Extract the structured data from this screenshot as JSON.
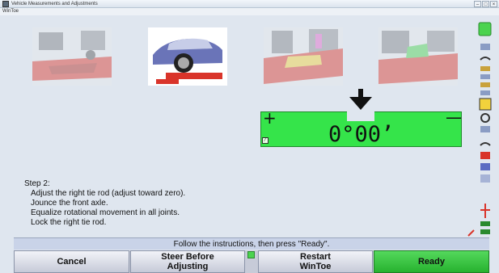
{
  "window": {
    "title": "Vehicle Measurements and Adjustments",
    "menu_label": "WinToe",
    "buttons": {
      "minimize": "–",
      "maximize": "□",
      "close": "×"
    }
  },
  "thumbnails": [
    {
      "name": "thumb-suspension-1",
      "icon": "suspension-icon"
    },
    {
      "name": "thumb-car-on-lift",
      "icon": "car-on-lift-icon"
    },
    {
      "name": "thumb-suspension-2",
      "icon": "tie-rod-icon"
    },
    {
      "name": "thumb-suspension-3",
      "icon": "steering-joint-icon"
    }
  ],
  "gauge": {
    "plus": "+",
    "minus": "—",
    "value": "0°00’",
    "color": "#35e44a",
    "pointer_icon": "down-arrow-icon"
  },
  "instructions": {
    "step": "Step 2:",
    "lines": [
      "Adjust the right tie rod (adjust toward zero).",
      "Jounce the front axle.",
      "Equalize rotational movement in all joints.",
      "Lock the right tie rod."
    ]
  },
  "status": "Follow the instructions, then press \"Ready\".",
  "buttons": {
    "cancel": "Cancel",
    "steer_line1": "Steer Before",
    "steer_line2": "Adjusting",
    "restart_line1": "Restart",
    "restart_line2": "WinToe",
    "ready": "Ready"
  },
  "colors": {
    "ready": "#2fbf37",
    "gauge": "#35e44a",
    "thumb_red": "#d9342a"
  }
}
